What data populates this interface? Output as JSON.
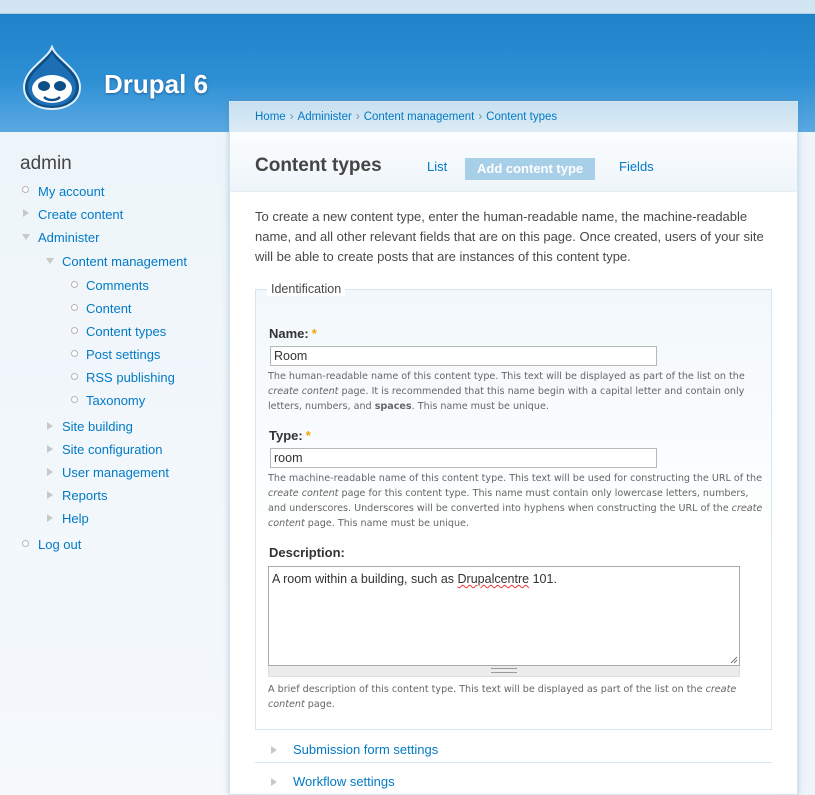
{
  "site": {
    "name": "Drupal 6",
    "logo_icon": "drupal-drop-icon"
  },
  "sidebar": {
    "title": "admin",
    "items": [
      {
        "label": "My account"
      },
      {
        "label": "Create content"
      },
      {
        "label": "Administer"
      },
      {
        "label": "Content management"
      },
      {
        "label": "Comments"
      },
      {
        "label": "Content"
      },
      {
        "label": "Content types"
      },
      {
        "label": "Post settings"
      },
      {
        "label": "RSS publishing"
      },
      {
        "label": "Taxonomy"
      },
      {
        "label": "Site building"
      },
      {
        "label": "Site configuration"
      },
      {
        "label": "User management"
      },
      {
        "label": "Reports"
      },
      {
        "label": "Help"
      },
      {
        "label": "Log out"
      }
    ]
  },
  "breadcrumb": [
    "Home",
    "Administer",
    "Content management",
    "Content types"
  ],
  "breadcrumb_sep": "›",
  "page": {
    "title": "Content types",
    "tabs": [
      "List",
      "Add content type",
      "Fields"
    ],
    "intro": "To create a new content type, enter the human-readable name, the machine-readable name, and all other relevant fields that are on this page. Once created, users of your site will be able to create posts that are instances of this content type."
  },
  "form": {
    "legend": "Identification",
    "required_mark": "*",
    "name": {
      "label": "Name:",
      "value": "Room",
      "desc_1": "The human-readable name of this content type. This text will be displayed as part of the list on the ",
      "desc_em": "create content",
      "desc_2": " page. It is recommended that this name begin with a capital letter and contain only letters, numbers, and ",
      "desc_strong": "spaces",
      "desc_3": ". This name must be unique."
    },
    "type": {
      "label": "Type:",
      "value": "room",
      "desc_1": "The machine-readable name of this content type. This text will be used for constructing the URL of the ",
      "desc_em1": "create content",
      "desc_2": " page for this content type. This name must contain only lowercase letters, numbers, and underscores. Underscores will be converted into hyphens when constructing the URL of the ",
      "desc_em2": "create content",
      "desc_3": " page. This name must be unique."
    },
    "description": {
      "label": "Description:",
      "value_1": "A room within a building, such as ",
      "value_misspelled": "Drupalcentre",
      "value_2": " 101.",
      "desc_1": "A brief description of this content type. This text will be displayed as part of the list on the ",
      "desc_em": "create content",
      "desc_2": " page."
    }
  },
  "collapsed_sections": [
    "Submission form settings",
    "Workflow settings"
  ]
}
